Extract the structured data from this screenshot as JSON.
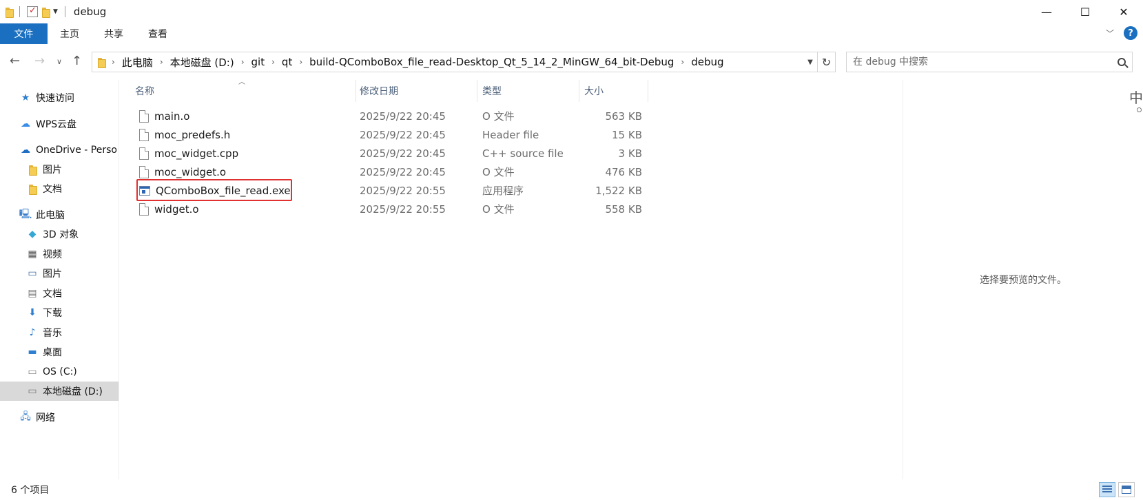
{
  "window": {
    "title": "debug",
    "minimize": "—",
    "maximize": "☐",
    "close": "✕"
  },
  "ribbon": {
    "tabs": [
      "文件",
      "主页",
      "共享",
      "查看"
    ],
    "collapse": "﹀",
    "help": "?"
  },
  "address": {
    "crumbs": [
      "此电脑",
      "本地磁盘 (D:)",
      "git",
      "qt",
      "build-QComboBox_file_read-Desktop_Qt_5_14_2_MinGW_64_bit-Debug",
      "debug"
    ],
    "separator": "›",
    "search_placeholder": "在 debug 中搜索"
  },
  "nav": {
    "items": [
      {
        "label": "快速访问",
        "icon": "star-icon"
      },
      {
        "label": "WPS云盘",
        "icon": "cloud-icon"
      },
      {
        "label": "OneDrive - Perso",
        "icon": "onedrive-icon"
      },
      {
        "label": "图片",
        "icon": "folder-icon"
      },
      {
        "label": "文档",
        "icon": "folder-icon"
      },
      {
        "label": "此电脑",
        "icon": "computer-icon"
      },
      {
        "label": "3D 对象",
        "icon": "cube-icon"
      },
      {
        "label": "视频",
        "icon": "video-icon"
      },
      {
        "label": "图片",
        "icon": "pictures-icon"
      },
      {
        "label": "文档",
        "icon": "documents-icon"
      },
      {
        "label": "下载",
        "icon": "download-icon"
      },
      {
        "label": "音乐",
        "icon": "music-icon"
      },
      {
        "label": "桌面",
        "icon": "desktop-icon"
      },
      {
        "label": "OS (C:)",
        "icon": "drive-icon"
      },
      {
        "label": "本地磁盘 (D:)",
        "icon": "drive-icon"
      },
      {
        "label": "网络",
        "icon": "network-icon"
      }
    ],
    "selected": "本地磁盘 (D:)"
  },
  "columns": {
    "name": "名称",
    "modified": "修改日期",
    "type": "类型",
    "size": "大小"
  },
  "files": [
    {
      "name": "main.o",
      "modified": "2025/9/22 20:45",
      "type": "O 文件",
      "size": "563 KB",
      "icon": "file-icon"
    },
    {
      "name": "moc_predefs.h",
      "modified": "2025/9/22 20:45",
      "type": "Header file",
      "size": "15 KB",
      "icon": "file-icon"
    },
    {
      "name": "moc_widget.cpp",
      "modified": "2025/9/22 20:45",
      "type": "C++ source file",
      "size": "3 KB",
      "icon": "file-icon"
    },
    {
      "name": "moc_widget.o",
      "modified": "2025/9/22 20:45",
      "type": "O 文件",
      "size": "476 KB",
      "icon": "file-icon"
    },
    {
      "name": "QComboBox_file_read.exe",
      "modified": "2025/9/22 20:55",
      "type": "应用程序",
      "size": "1,522 KB",
      "icon": "exe-icon"
    },
    {
      "name": "widget.o",
      "modified": "2025/9/22 20:55",
      "type": "O 文件",
      "size": "558 KB",
      "icon": "file-icon"
    }
  ],
  "highlighted_file": "QComboBox_file_read.exe",
  "highlight_color": "#e03030",
  "accent_color": "#1a6fc0",
  "preview": {
    "message": "选择要预览的文件。",
    "ime_indicator": "中"
  },
  "status": {
    "item_count": "6 个项目"
  }
}
